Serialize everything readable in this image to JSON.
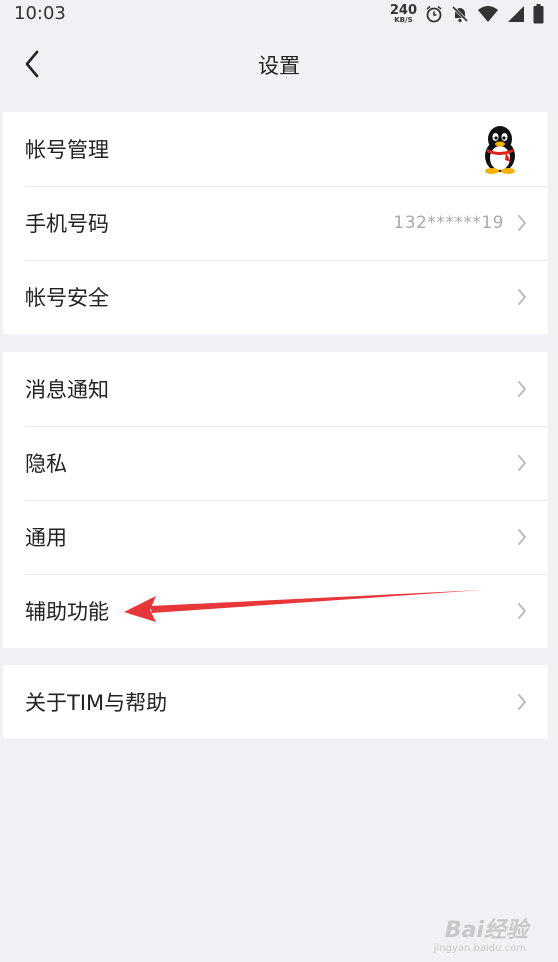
{
  "status_bar": {
    "time": "10:03",
    "net_speed_value": "240",
    "net_speed_unit": "KB/S",
    "icons": [
      "alarm-icon",
      "mute-icon",
      "wifi-icon",
      "signal-icon",
      "battery-icon"
    ]
  },
  "header": {
    "title": "设置",
    "back_icon": "chevron-left-icon"
  },
  "groups": [
    {
      "items": [
        {
          "label": "帐号管理",
          "accessory": "qq-penguin-avatar"
        },
        {
          "label": "手机号码",
          "value": "132******19",
          "accessory": "chevron-right-icon"
        },
        {
          "label": "帐号安全",
          "accessory": "chevron-right-icon"
        }
      ]
    },
    {
      "items": [
        {
          "label": "消息通知",
          "accessory": "chevron-right-icon"
        },
        {
          "label": "隐私",
          "accessory": "chevron-right-icon"
        },
        {
          "label": "通用",
          "accessory": "chevron-right-icon"
        },
        {
          "label": "辅助功能",
          "accessory": "chevron-right-icon"
        }
      ]
    },
    {
      "items": [
        {
          "label": "关于TIM与帮助",
          "accessory": "chevron-right-icon"
        }
      ]
    }
  ],
  "annotation": {
    "type": "red-arrow",
    "color": "#e8373a"
  },
  "watermark": {
    "text": "Bai经验",
    "sub": "jingyan.baidu.com"
  },
  "colors": {
    "background": "#f1f1f5",
    "card": "#ffffff",
    "text": "#222222",
    "secondary": "#aaaaaa"
  }
}
